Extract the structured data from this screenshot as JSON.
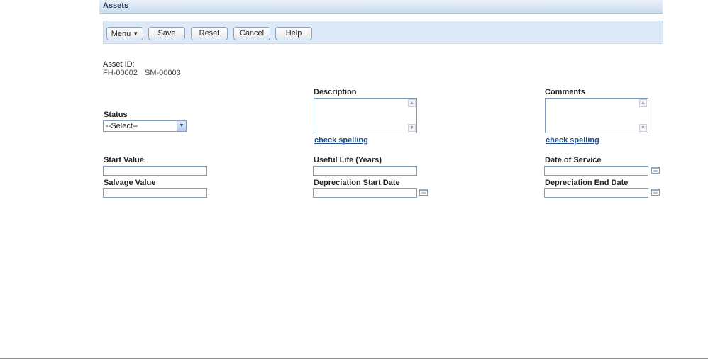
{
  "header": {
    "title": "Assets"
  },
  "toolbar": {
    "menu_label": "Menu",
    "save_label": "Save",
    "reset_label": "Reset",
    "cancel_label": "Cancel",
    "help_label": "Help"
  },
  "asset": {
    "id_label": "Asset ID:",
    "ids": [
      "FH-00002",
      "SM-00003"
    ]
  },
  "form": {
    "status": {
      "label": "Status",
      "selected": "--Select--"
    },
    "description": {
      "label": "Description",
      "value": ""
    },
    "comments": {
      "label": "Comments",
      "value": ""
    },
    "check_spelling": "check spelling",
    "start_value": {
      "label": "Start Value",
      "value": ""
    },
    "useful_life": {
      "label": "Useful Life (Years)",
      "value": ""
    },
    "date_of_service": {
      "label": "Date of Service",
      "value": ""
    },
    "salvage_value": {
      "label": "Salvage Value",
      "value": ""
    },
    "depreciation_start_date": {
      "label": "Depreciation Start Date",
      "value": ""
    },
    "depreciation_end_date": {
      "label": "Depreciation End Date",
      "value": ""
    }
  },
  "colors": {
    "toolbar_bg": "#dde9f6",
    "title_bar_bg": "#c9dbee",
    "link": "#1f4e8c"
  }
}
